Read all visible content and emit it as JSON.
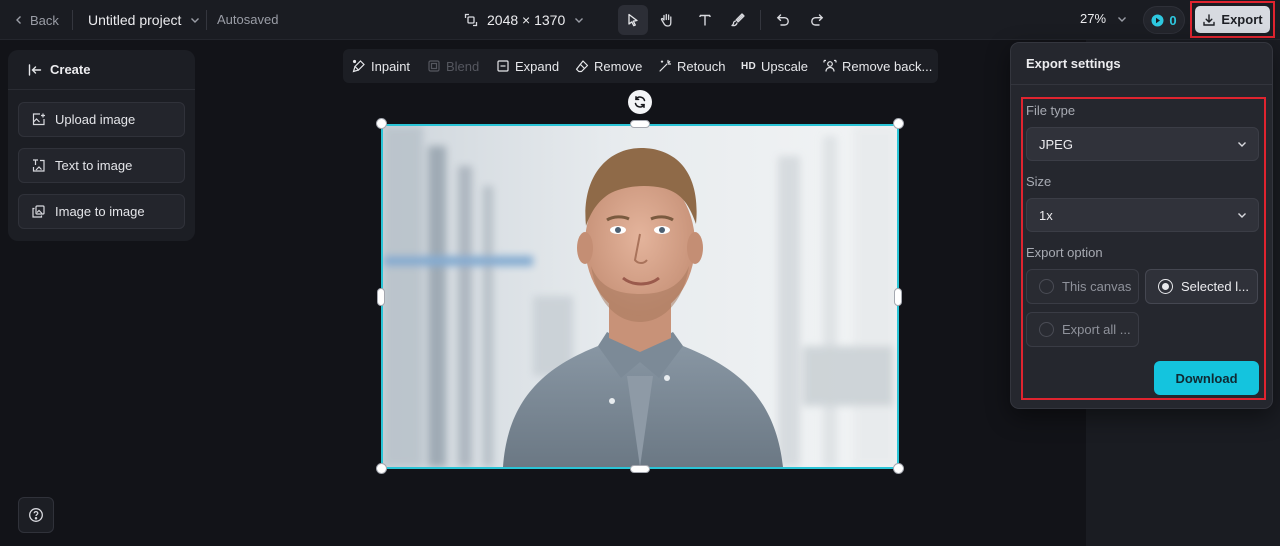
{
  "topbar": {
    "back_label": "Back",
    "project_name": "Untitled project",
    "autosave_status": "Autosaved",
    "canvas_size": "2048 × 1370",
    "zoom": "27%",
    "credits": "0",
    "export_label": "Export",
    "tools": [
      "select-icon",
      "hand-icon",
      "text-icon",
      "brush-icon",
      "undo-icon",
      "redo-icon"
    ]
  },
  "left_panel": {
    "title": "Create",
    "items": [
      {
        "label": "Upload image",
        "icon": "upload-image-icon"
      },
      {
        "label": "Text to image",
        "icon": "text-to-image-icon"
      },
      {
        "label": "Image to image",
        "icon": "image-to-image-icon"
      }
    ]
  },
  "canvas_toolbar": {
    "items": [
      {
        "label": "Inpaint",
        "enabled": true
      },
      {
        "label": "Blend",
        "enabled": false
      },
      {
        "label": "Expand",
        "enabled": true
      },
      {
        "label": "Remove",
        "enabled": true
      },
      {
        "label": "Retouch",
        "enabled": true
      },
      {
        "label": "Upscale",
        "enabled": true,
        "badge": "HD"
      },
      {
        "label": "Remove back...",
        "enabled": true
      }
    ]
  },
  "export_panel": {
    "title": "Export settings",
    "file_type_label": "File type",
    "file_type_value": "JPEG",
    "size_label": "Size",
    "size_value": "1x",
    "export_option_label": "Export option",
    "options": [
      {
        "label": "This canvas",
        "selected": false
      },
      {
        "label": "Selected l...",
        "selected": true
      },
      {
        "label": "Export all ...",
        "selected": false
      }
    ],
    "download_label": "Download"
  },
  "colors": {
    "accent": "#14c4de",
    "selection": "#2ac4d6",
    "highlight": "#e0242f",
    "background": "#121318"
  }
}
